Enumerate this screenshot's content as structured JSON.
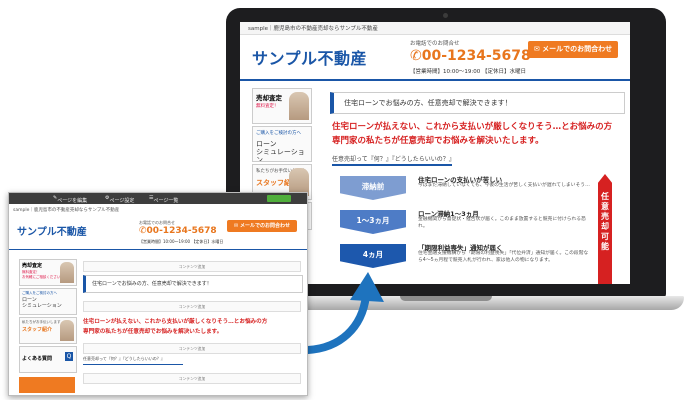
{
  "site": {
    "breadcrumb": "sample｜鹿児島市の不動産売却ならサンプル不動産",
    "logo": "サンプル不動産",
    "contact_label": "お電話でのお問合せ",
    "phone": "00-1234-5678",
    "hours": "【営業時間】10:00～19:00 【定休日】水曜日",
    "mail_button": "メールでのお問合わせ",
    "notice": "住宅ローンでお悩みの方、任意売却で解決できます！",
    "headline_1": "住宅ローンが払えない、これから支払いが厳しくなりそう…とお悩みの方",
    "headline_2": "専門家の私たちが任意売却でお悩みを解決いたします。",
    "question": "任意売却って『何？』『どうしたらいいの？』",
    "content_area": "コンテンツ追加",
    "vertical_label": "任意売却可能"
  },
  "sidebar": {
    "item_1": {
      "title": "売却査定",
      "sub": "無料査定！",
      "sub2": "お気軽にご相談ください"
    },
    "item_2": {
      "sub": "ご購入をご検討の方へ",
      "title_1": "ローン",
      "title_2": "シミュレーション"
    },
    "item_3": {
      "sub": "私たちがお手伝いします",
      "title": "スタッフ紹介"
    },
    "item_4": {
      "title": "よくある質問"
    }
  },
  "steps": [
    {
      "label": "滞納前",
      "title": "住宅ローンの支払いが苦しい",
      "desc": "今はまだ滞納していなくても、今後の生活が苦しく支払いが遅れてしまいそう…"
    },
    {
      "label": "1～3ヵ月",
      "title": "ローン滞納1～3ヵ月",
      "desc": "金融機関から督促状・催告状が届く。このまま放置すると競売に付けられる恐れ。"
    },
    {
      "label": "4ヵ月",
      "title": "「期限利益喪失」通知が届く",
      "desc": "住宅金融支援機構から「期限の利益喪失」「代位弁済」通知が届く。この段階なら4～5ヵ月程で競売入札が行われ、家は他人の物になります。"
    }
  ],
  "editor_bar": {
    "edit_page": "ページを編集",
    "page_info": "ページ設定",
    "page_list": "ページ一覧"
  },
  "colors": {
    "brand_blue": "#1a56a7",
    "accent_orange": "#ef7a21",
    "alert_red": "#d62121",
    "arrow_blue": "#1e73be"
  }
}
